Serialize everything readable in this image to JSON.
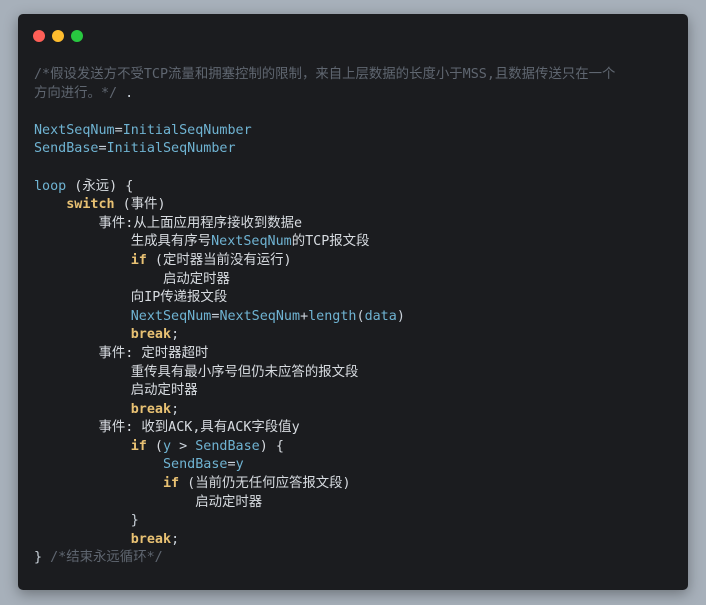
{
  "colors": {
    "window_bg": "#1b1c1f",
    "dot_close": "#ff5f57",
    "dot_minimize": "#febc2e",
    "dot_zoom": "#28c840"
  },
  "code": [
    [
      {
        "t": "/*假设发送方不受TCP流量和拥塞控制的限制，来自上层数据的长度小于MSS,且数据传送只在一个",
        "c": "comment"
      }
    ],
    [
      {
        "t": "方向进行。*/",
        "c": "comment"
      },
      {
        "t": " .",
        "c": "punc"
      }
    ],
    [],
    [
      {
        "t": "NextSeqNum",
        "c": "ident"
      },
      {
        "t": "=",
        "c": "op"
      },
      {
        "t": "InitialSeqNumber",
        "c": "ident"
      }
    ],
    [
      {
        "t": "SendBase",
        "c": "ident"
      },
      {
        "t": "=",
        "c": "op"
      },
      {
        "t": "InitialSeqNumber",
        "c": "ident"
      }
    ],
    [],
    [
      {
        "t": "loop",
        "c": "ident"
      },
      {
        "t": " (永远) {",
        "c": "text"
      }
    ],
    [
      {
        "t": "    "
      },
      {
        "t": "switch",
        "c": "kw"
      },
      {
        "t": " (事件)",
        "c": "text"
      }
    ],
    [
      {
        "t": "        "
      },
      {
        "t": "事件:从上面应用程序接收到数据e",
        "c": "text"
      }
    ],
    [
      {
        "t": "            "
      },
      {
        "t": "生成具有序号",
        "c": "text"
      },
      {
        "t": "NextSeqNum",
        "c": "ident"
      },
      {
        "t": "的TCP报文段",
        "c": "text"
      }
    ],
    [
      {
        "t": "            "
      },
      {
        "t": "if",
        "c": "kw"
      },
      {
        "t": " (定时器当前没有运行)",
        "c": "text"
      }
    ],
    [
      {
        "t": "                "
      },
      {
        "t": "启动定时器",
        "c": "text"
      }
    ],
    [
      {
        "t": "            "
      },
      {
        "t": "向IP传递报文段",
        "c": "text"
      }
    ],
    [
      {
        "t": "            "
      },
      {
        "t": "NextSeqNum",
        "c": "ident"
      },
      {
        "t": "=",
        "c": "op"
      },
      {
        "t": "NextSeqNum",
        "c": "ident"
      },
      {
        "t": "+",
        "c": "op"
      },
      {
        "t": "length",
        "c": "func"
      },
      {
        "t": "(",
        "c": "punc"
      },
      {
        "t": "data",
        "c": "ident"
      },
      {
        "t": ")",
        "c": "punc"
      }
    ],
    [
      {
        "t": "            "
      },
      {
        "t": "break",
        "c": "kw"
      },
      {
        "t": ";",
        "c": "punc"
      }
    ],
    [
      {
        "t": "        "
      },
      {
        "t": "事件: 定时器超时",
        "c": "text"
      }
    ],
    [
      {
        "t": "            "
      },
      {
        "t": "重传具有最小序号但仍未应答的报文段",
        "c": "text"
      }
    ],
    [
      {
        "t": "            "
      },
      {
        "t": "启动定时器",
        "c": "text"
      }
    ],
    [
      {
        "t": "            "
      },
      {
        "t": "break",
        "c": "kw"
      },
      {
        "t": ";",
        "c": "punc"
      }
    ],
    [
      {
        "t": "        "
      },
      {
        "t": "事件: 收到ACK,具有ACK字段值y",
        "c": "text"
      }
    ],
    [
      {
        "t": "            "
      },
      {
        "t": "if",
        "c": "kw"
      },
      {
        "t": " (",
        "c": "text"
      },
      {
        "t": "y",
        "c": "ident"
      },
      {
        "t": " > ",
        "c": "op"
      },
      {
        "t": "SendBase",
        "c": "ident"
      },
      {
        "t": ") {",
        "c": "text"
      }
    ],
    [
      {
        "t": "                "
      },
      {
        "t": "SendBase",
        "c": "ident"
      },
      {
        "t": "=",
        "c": "op"
      },
      {
        "t": "y",
        "c": "ident"
      }
    ],
    [
      {
        "t": "                "
      },
      {
        "t": "if",
        "c": "kw"
      },
      {
        "t": " (当前仍无任何应答报文段)",
        "c": "text"
      }
    ],
    [
      {
        "t": "                    "
      },
      {
        "t": "启动定时器",
        "c": "text"
      }
    ],
    [
      {
        "t": "            "
      },
      {
        "t": "}",
        "c": "punc"
      }
    ],
    [
      {
        "t": "            "
      },
      {
        "t": "break",
        "c": "kw"
      },
      {
        "t": ";",
        "c": "punc"
      }
    ],
    [
      {
        "t": "}",
        "c": "punc"
      },
      {
        "t": " /*结束永远循环*/",
        "c": "comment"
      }
    ]
  ]
}
